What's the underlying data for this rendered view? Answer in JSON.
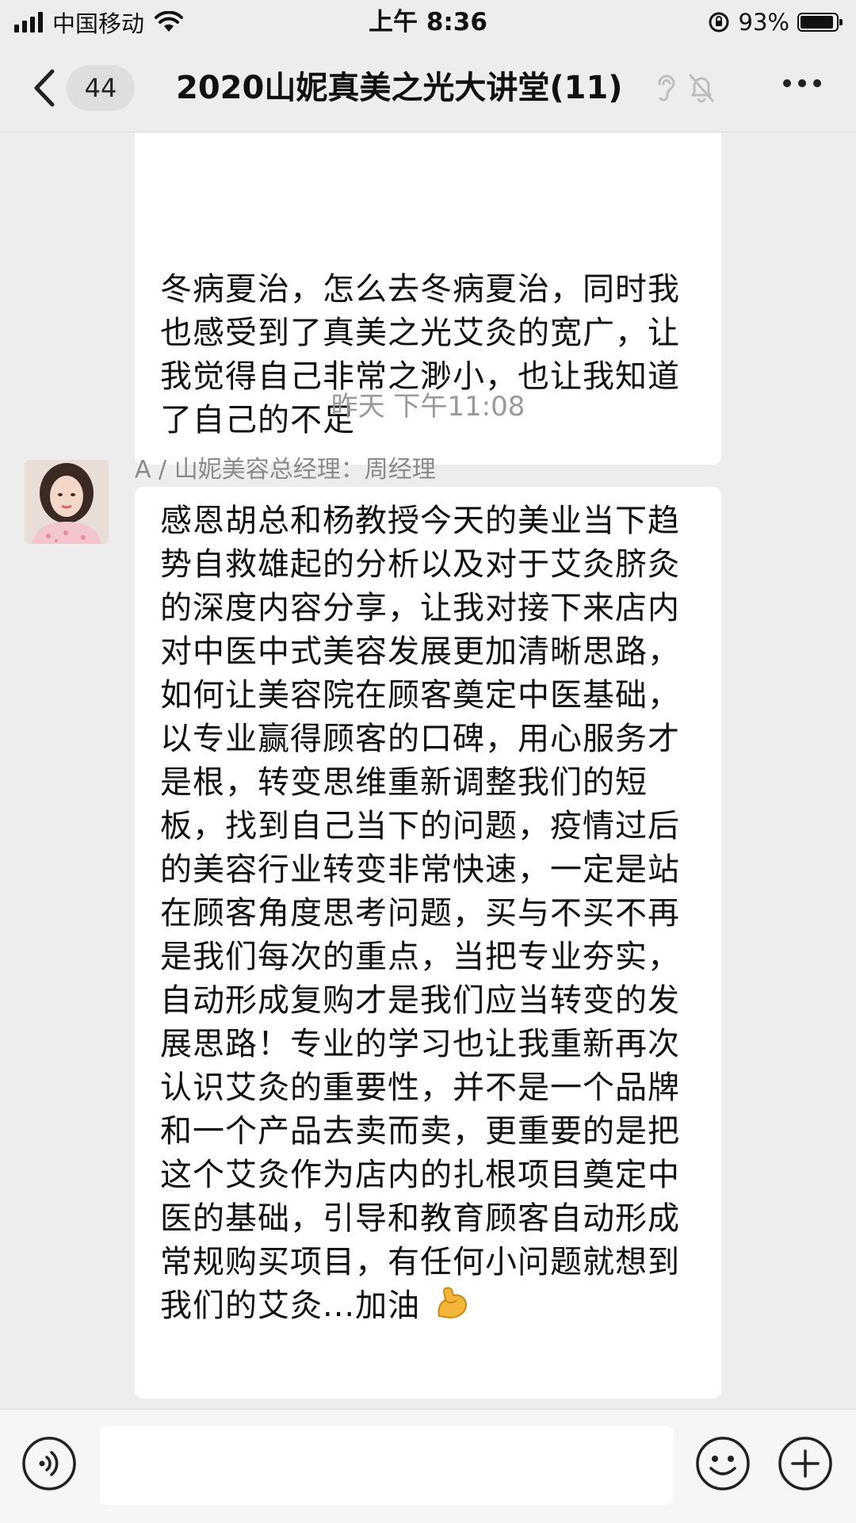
{
  "status_bar": {
    "carrier": "中国移动",
    "time": "上午 8:36",
    "battery_text": "93%",
    "battery_level": 0.93
  },
  "nav": {
    "unread_count": "44",
    "title": "2020山妮真美之光大讲堂(11)"
  },
  "messages": {
    "prev_text": "冬病夏治，怎么去冬病夏治，同时我也感受到了真美之光艾灸的宽广，让我觉得自己非常之渺小，也让我知道了自己的不足",
    "timestamp": "昨天 下午11:08",
    "sender": "A / 山妮美容总经理：周经理",
    "main_text": "感恩胡总和杨教授今天的美业当下趋势自救雄起的分析以及对于艾灸脐灸的深度内容分享，让我对接下来店内对中医中式美容发展更加清晰思路，如何让美容院在顾客奠定中医基础，以专业赢得顾客的口碑，用心服务才是根，转变思维重新调整我们的短板，找到自己当下的问题，疫情过后的美容行业转变非常快速，一定是站在顾客角度思考问题，买与不买不再是我们每次的重点，当把专业夯实，自动形成复购才是我们应当转变的发展思路！专业的学习也让我重新再次认识艾灸的重要性，并不是一个品牌和一个产品去卖而卖，更重要的是把这个艾灸作为店内的扎根项目奠定中医的基础，引导和教育顾客自动形成常规购买项目，有任何小问题就想到我们的艾灸...加油",
    "main_emoji": "flexed-biceps-icon"
  },
  "input_bar": {
    "placeholder": "",
    "icons": [
      "voice-icon",
      "emoji-icon",
      "plus-icon"
    ]
  }
}
